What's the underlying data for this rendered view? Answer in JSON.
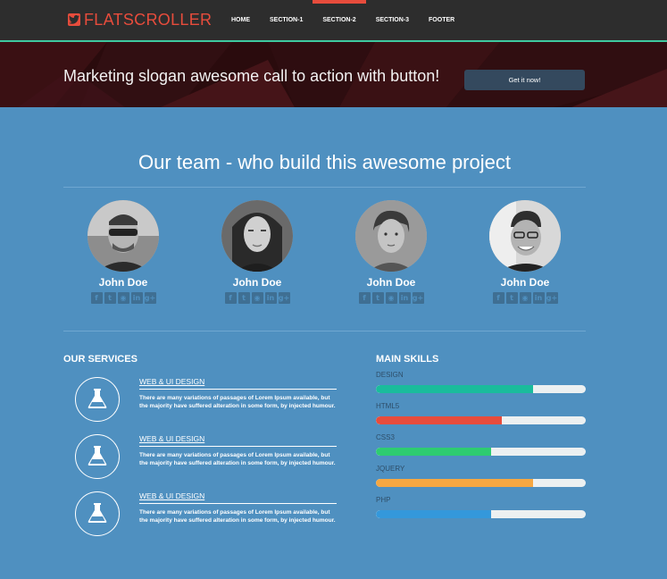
{
  "brand": {
    "name": "FLATSCROLLER",
    "icon": "twitter-icon",
    "color": "#e74c3c"
  },
  "nav": {
    "items": [
      "HOME",
      "SECTION-1",
      "SECTION-2",
      "SECTION-3",
      "FOOTER"
    ],
    "active": "SECTION-2"
  },
  "hero": {
    "slogan": "Marketing slogan awesome call to action with button!",
    "button_label": "Get it now!"
  },
  "team": {
    "title": "Our team - who build this awesome project",
    "members": [
      {
        "name": "John Doe"
      },
      {
        "name": "John Doe"
      },
      {
        "name": "John Doe"
      },
      {
        "name": "John Doe"
      }
    ],
    "social_icons": [
      "facebook-icon",
      "twitter-icon",
      "github-icon",
      "linkedin-icon",
      "google-plus-icon"
    ]
  },
  "services": {
    "heading": "OUR SERVICES",
    "items": [
      {
        "title": "WEB & UI DESIGN",
        "text": "There are many variations of passages of Lorem Ipsum available, but the majority have suffered alteration in some form, by injected humour.",
        "icon": "flask-icon"
      },
      {
        "title": "WEB & UI DESIGN",
        "text": "There are many variations of passages of Lorem Ipsum available, but the majority have suffered alteration in some form, by injected humour.",
        "icon": "flask-icon"
      },
      {
        "title": "WEB & UI DESIGN",
        "text": "There are many variations of passages of Lorem Ipsum available, but the majority have suffered alteration in some form, by injected humour.",
        "icon": "flask-icon"
      }
    ]
  },
  "skills": {
    "heading": "MAIN SKILLS",
    "items": [
      {
        "label": "DESIGN",
        "level": 0.75,
        "color": "#1abc9c"
      },
      {
        "label": "HTML5",
        "level": 0.6,
        "color": "#e74c3c"
      },
      {
        "label": "CSS3",
        "level": 0.55,
        "color": "#2ecc71"
      },
      {
        "label": "JQUERY",
        "level": 0.75,
        "color": "#f5a742"
      },
      {
        "label": "PHP",
        "level": 0.55,
        "color": "#3498db"
      }
    ]
  }
}
